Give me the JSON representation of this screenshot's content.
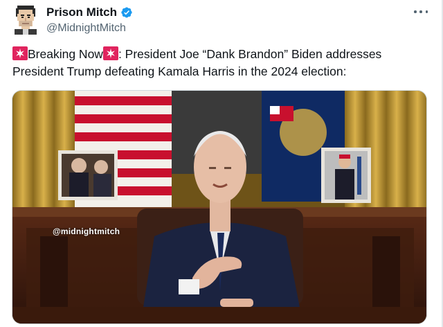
{
  "author": {
    "display_name": "Prison Mitch",
    "handle": "@MidnightMitch",
    "verified": true,
    "avatar_icon": "pixel-art-avatar-icon"
  },
  "more_menu_icon": "ellipsis-icon",
  "tweet": {
    "siren_icon": "rotating-light-emoji-icon",
    "prefix": "Breaking Now",
    "body": ": President Joe “Dank Brandon” Biden addresses President Trump defeating Kamala Harris in the 2024 election:"
  },
  "media": {
    "watermark": "@midnightmitch"
  },
  "colors": {
    "verified_blue": "#1d9bf0",
    "text_primary": "#0f1419",
    "text_secondary": "#536471",
    "siren_red": "#e0245e"
  }
}
